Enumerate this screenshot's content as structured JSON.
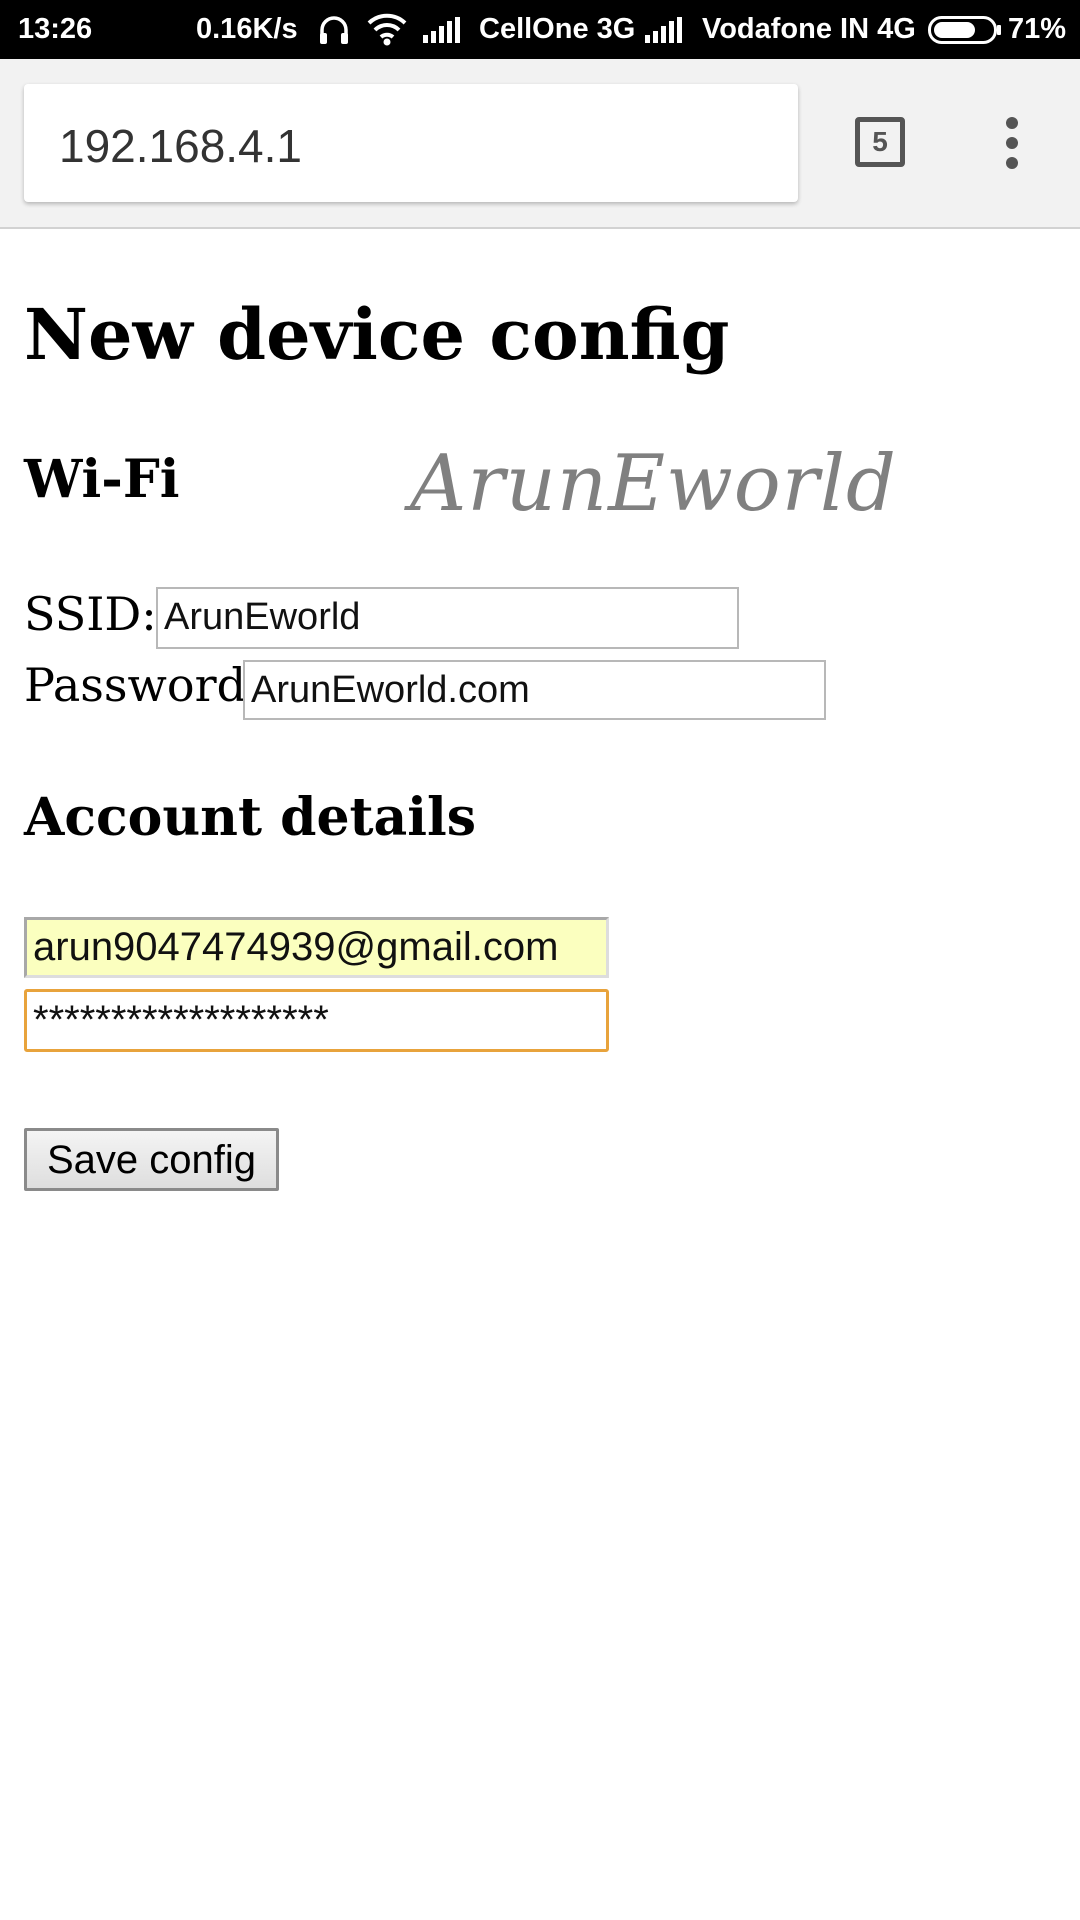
{
  "status_bar": {
    "time": "13:26",
    "speed": "0.16K/s",
    "carrier1": "CellOne 3G",
    "carrier2": "Vodafone IN 4G",
    "battery_percent": "71%",
    "battery_level": 0.71
  },
  "browser": {
    "url": "192.168.4.1",
    "tab_count": "5"
  },
  "page": {
    "title": "New device config",
    "wifi_heading": "Wi-Fi",
    "logo_text": "ArunEworld",
    "ssid_label": "SSID:",
    "ssid_value": "ArunEworld",
    "password_label": "Password",
    "password_value": "ArunEworld.com",
    "account_heading": "Account details",
    "email_value": "arun9047474939@gmail.com",
    "account_password_value": "*******************",
    "save_label": "Save config"
  },
  "colors": {
    "autofill_bg": "#fbffbf",
    "focus_border": "#e8a33c",
    "logo": "#808080"
  }
}
